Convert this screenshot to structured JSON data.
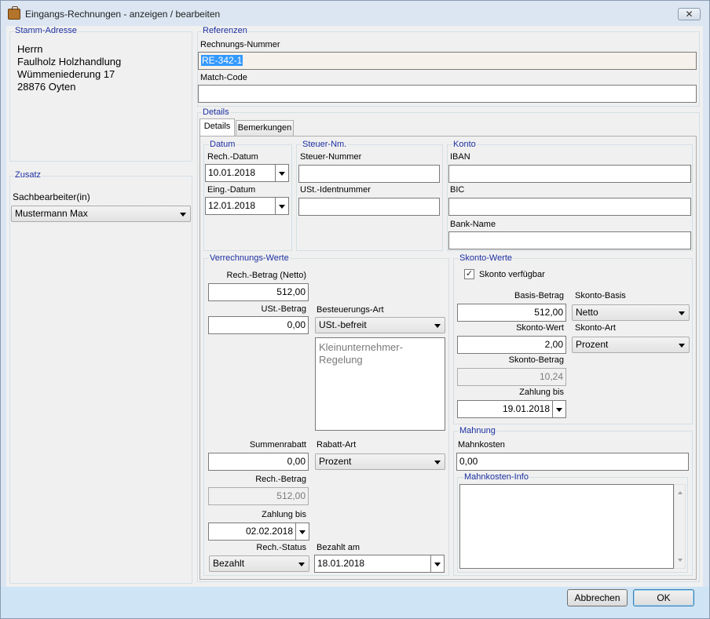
{
  "window": {
    "title": "Eingangs-Rechnungen - anzeigen / bearbeiten",
    "close_label": "✕"
  },
  "stamm": {
    "group_label": "Stamm-Adresse",
    "lines": [
      "Herrn",
      "Faulholz Holzhandlung",
      "Wümmeniederung 17",
      "28876 Oyten"
    ]
  },
  "zusatz": {
    "group_label": "Zusatz",
    "sachbearbeiter_label": "Sachbearbeiter(in)",
    "sachbearbeiter_value": "Mustermann Max"
  },
  "referenzen": {
    "group_label": "Referenzen",
    "rechnungsnummer_label": "Rechnungs-Nummer",
    "rechnungsnummer_value": "RE-342-1",
    "matchcode_label": "Match-Code",
    "matchcode_value": ""
  },
  "details": {
    "group_label": "Details",
    "tabs": [
      {
        "label": "Details"
      },
      {
        "label": "Bemerkungen"
      }
    ],
    "datum": {
      "group_label": "Datum",
      "rech_datum_label": "Rech.-Datum",
      "rech_datum_value": "10.01.2018",
      "eing_datum_label": "Eing.-Datum",
      "eing_datum_value": "12.01.2018"
    },
    "steuer": {
      "group_label": "Steuer-Nm.",
      "steuernummer_label": "Steuer-Nummer",
      "steuernummer_value": "",
      "ustid_label": "USt.-Identnummer",
      "ustid_value": ""
    },
    "konto": {
      "group_label": "Konto",
      "iban_label": "IBAN",
      "iban_value": "",
      "bic_label": "BIC",
      "bic_value": "",
      "bankname_label": "Bank-Name",
      "bankname_value": ""
    },
    "verrechnung": {
      "group_label": "Verrechnungs-Werte",
      "netto_label": "Rech.-Betrag (Netto)",
      "netto_value": "512,00",
      "ust_label": "USt.-Betrag",
      "ust_value": "0,00",
      "besteuerung_label": "Besteuerungs-Art",
      "besteuerung_value": "USt.-befreit",
      "besteuerung_info": "Kleinunternehmer-Regelung",
      "summenrabatt_label": "Summenrabatt",
      "summenrabatt_value": "0,00",
      "rabattart_label": "Rabatt-Art",
      "rabattart_value": "Prozent",
      "rechbetrag_label": "Rech.-Betrag",
      "rechbetrag_value": "512,00",
      "zahlungbis_label": "Zahlung bis",
      "zahlungbis_value": "02.02.2018",
      "status_label": "Rech.-Status",
      "status_value": "Bezahlt",
      "bezahltam_label": "Bezahlt am",
      "bezahltam_value": "18.01.2018"
    },
    "skonto": {
      "group_label": "Skonto-Werte",
      "verfuegbar_label": "Skonto verfügbar",
      "verfuegbar_checked": true,
      "basisbetrag_label": "Basis-Betrag",
      "basisbetrag_value": "512,00",
      "basis_label": "Skonto-Basis",
      "basis_value": "Netto",
      "wert_label": "Skonto-Wert",
      "wert_value": "2,00",
      "art_label": "Skonto-Art",
      "art_value": "Prozent",
      "betrag_label": "Skonto-Betrag",
      "betrag_value": "10,24",
      "zahlungbis_label": "Zahlung bis",
      "zahlungbis_value": "19.01.2018"
    },
    "mahnung": {
      "group_label": "Mahnung",
      "kosten_label": "Mahnkosten",
      "kosten_value": "0,00",
      "info_label": "Mahnkosten-Info",
      "info_value": ""
    }
  },
  "buttons": {
    "cancel": "Abbrechen",
    "ok": "OK"
  }
}
